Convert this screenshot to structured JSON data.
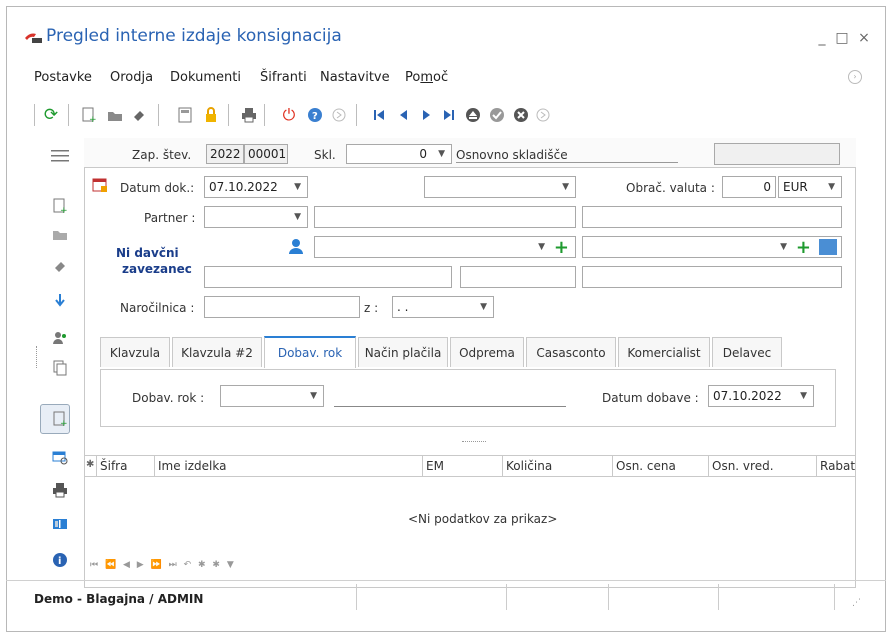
{
  "window": {
    "title": "Pregled interne izdaje konsignacija",
    "minimize": "_",
    "maximize": "□",
    "close": "×"
  },
  "menu": {
    "items": [
      "Postavke",
      "Orodja",
      "Dokumenti",
      "Šifranti",
      "Nastavitve"
    ],
    "help_prefix": "Po",
    "help_underlined": "m",
    "help_suffix": "oč"
  },
  "header": {
    "zap_label": "Zap. štev.",
    "zap_year": "2022",
    "zap_number": "00001",
    "skl_label": "Skl.",
    "skl_value": "0",
    "skl_name": "Osnovno skladišče"
  },
  "form": {
    "datum_label": "Datum dok.:",
    "datum_value": "07.10.2022",
    "obrac_label": "Obrač. valuta :",
    "obrac_value": "0",
    "currency": "EUR",
    "partner_label": "Partner :",
    "tax_status_line1": "Ni davčni",
    "tax_status_line2": "zavezanec",
    "narocilnica_label": "Naročilnica :",
    "z_label": "z :",
    "z_value": ". ."
  },
  "tabs": [
    {
      "label": "Klavzula"
    },
    {
      "label": "Klavzula #2"
    },
    {
      "label": "Dobav. rok"
    },
    {
      "label": "Način plačila"
    },
    {
      "label": "Odprema"
    },
    {
      "label": "Casasconto"
    },
    {
      "label": "Komercialist"
    },
    {
      "label": "Delavec"
    }
  ],
  "tab_panel": {
    "dobav_rok_label": "Dobav. rok :",
    "datum_dobave_label": "Datum dobave :",
    "datum_dobave_value": "07.10.2022"
  },
  "grid": {
    "columns": [
      "Šifra",
      "Ime izdelka",
      "EM",
      "Količina",
      "Osn. cena",
      "Osn. vred.",
      "Rabat"
    ],
    "empty_text": "<Ni podatkov za prikaz>",
    "nav": "⏮ ⏪ ◀ ▶ ⏩ ⏭ ↶ ✱ ✱ ▼"
  },
  "status": {
    "text": "Demo - Blagajna / ADMIN"
  },
  "colors": {
    "accent": "#2a63b3",
    "green": "#1e9a2e",
    "red": "#e03020",
    "tab_active": "#2a7fd4"
  }
}
